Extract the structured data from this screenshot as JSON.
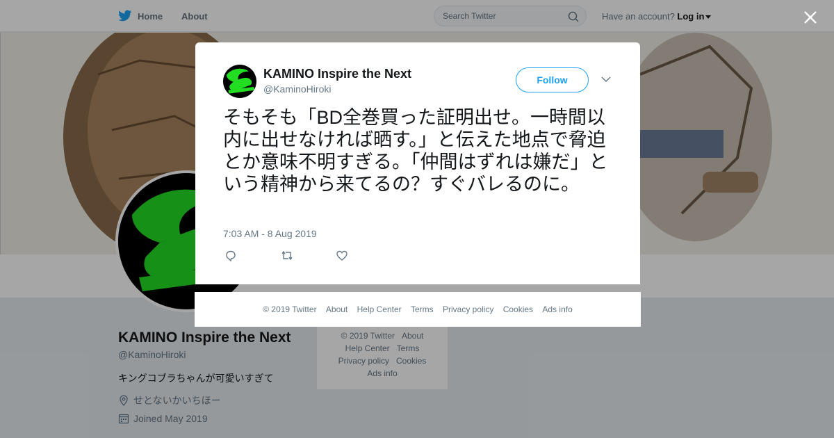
{
  "topbar": {
    "home_label": "Home",
    "about_label": "About",
    "search_placeholder": "Search Twitter",
    "account_prompt": "Have an account?",
    "login_label": "Log in"
  },
  "profile": {
    "name": "KAMINO Inspire the Next",
    "handle": "@KaminoHiroki",
    "bio": "キングコブラちゃんが可愛いすぎて",
    "location": "せとないかいちほー",
    "joined": "Joined May 2019"
  },
  "sidebar_footer": {
    "line1": [
      "© 2019 Twitter",
      "About"
    ],
    "line2": [
      "Help Center",
      "Terms"
    ],
    "line3": [
      "Privacy policy",
      "Cookies"
    ],
    "line4": [
      "Ads info"
    ]
  },
  "tweet": {
    "author_name": "KAMINO Inspire the Next",
    "author_handle": "@KaminoHiroki",
    "follow_label": "Follow",
    "text": "そもそも「BD全巻買った証明出せ。一時間以内に出せなければ晒す。」と伝えた地点で脅迫とか意味不明すぎる。「仲間はずれは嫌だ」という精神から来てるの？すぐバレるのに。",
    "timestamp": "7:03 AM - 8 Aug 2019"
  },
  "modal_footer": {
    "copyright": "© 2019 Twitter",
    "about": "About",
    "help": "Help Center",
    "terms": "Terms",
    "privacy": "Privacy policy",
    "cookies": "Cookies",
    "ads": "Ads info"
  },
  "colors": {
    "brand": "#1da1f2",
    "avatar_green": "#22dd22"
  }
}
